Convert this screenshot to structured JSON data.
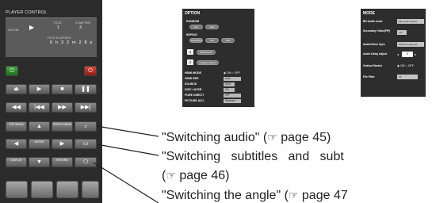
{
  "player_control": {
    "title": "PLAYER CONTROL",
    "status": {
      "mode": "AVCHD",
      "play_icon": "play-icon",
      "title_label": "TITLE",
      "title_value": "1",
      "chapter_label": "CHAPTER",
      "chapter_value": "3",
      "elapsed_label": "TITLE ELAPSED",
      "elapsed_value": "0 h 3 2 m 2 8 s"
    },
    "buttons": {
      "top_menu": "TOP MENU",
      "popup_menu": "POPUP MENU",
      "enter": "ENTER",
      "display": "DISPLAY",
      "return": "RETURN"
    },
    "power_on_color": "#2a9a2a",
    "power_off_color": "#c0392b"
  },
  "option": {
    "title": "OPTION",
    "random_label": "RANDOM",
    "random_on": "ON",
    "random_off": "OFF",
    "repeat_label": "REPEAT",
    "repeat_chapter": "CHAPTER",
    "repeat_all": "ALL",
    "repeat_off": "OFF",
    "title_number": "1",
    "title_search": "Title Search",
    "chapter_number": "1",
    "chapter_search": "Chapter Search",
    "hdmi_mode_label": "HDMI MODE",
    "hdmi_on": "ON",
    "hdmi_off": "OFF",
    "hdmi_res_label": "HDMI RES",
    "hdmi_res_value": "Auto",
    "source_label": "SOURCE",
    "source_value": "DISC",
    "disc_layer_label": "DISC LAYER",
    "disc_layer_value": "CD",
    "pure_direct_label": "PURE DIRECT",
    "pure_direct_value": "OFF",
    "picture_adj_label": "PICTURE ADJ.",
    "picture_adj_value": "Standard"
  },
  "mode": {
    "title": "MODE",
    "bd_audio_label": "BD Audio mode",
    "bd_audio_value": "Mix Audio Output",
    "secondary_video_label": "Secondary Video(PIP)",
    "secondary_video_value": "ON",
    "av_sync_label": "Audio/Video Sync",
    "av_sync_value": "HDMI Configured",
    "audio_delay_label": "Audio Delay Adjust",
    "audio_delay_value": "0",
    "vertical_stretch_label": "Vertical Stretch",
    "vertical_stretch_on": "ON",
    "vertical_stretch_off": "OFF",
    "file_filter_label": "File Filter",
    "file_filter_value": "All"
  },
  "callouts": {
    "line1_text": "\"Switching audio\" (",
    "line1_page": "page 45)",
    "line2_text": "\"Switching   subtitles   and   subt",
    "line3_open": "(",
    "line3_page": "page 46)",
    "line4_text": "\"Switching the angle\" (",
    "line4_page": "page 47",
    "page_icon": "page-reference-icon"
  }
}
